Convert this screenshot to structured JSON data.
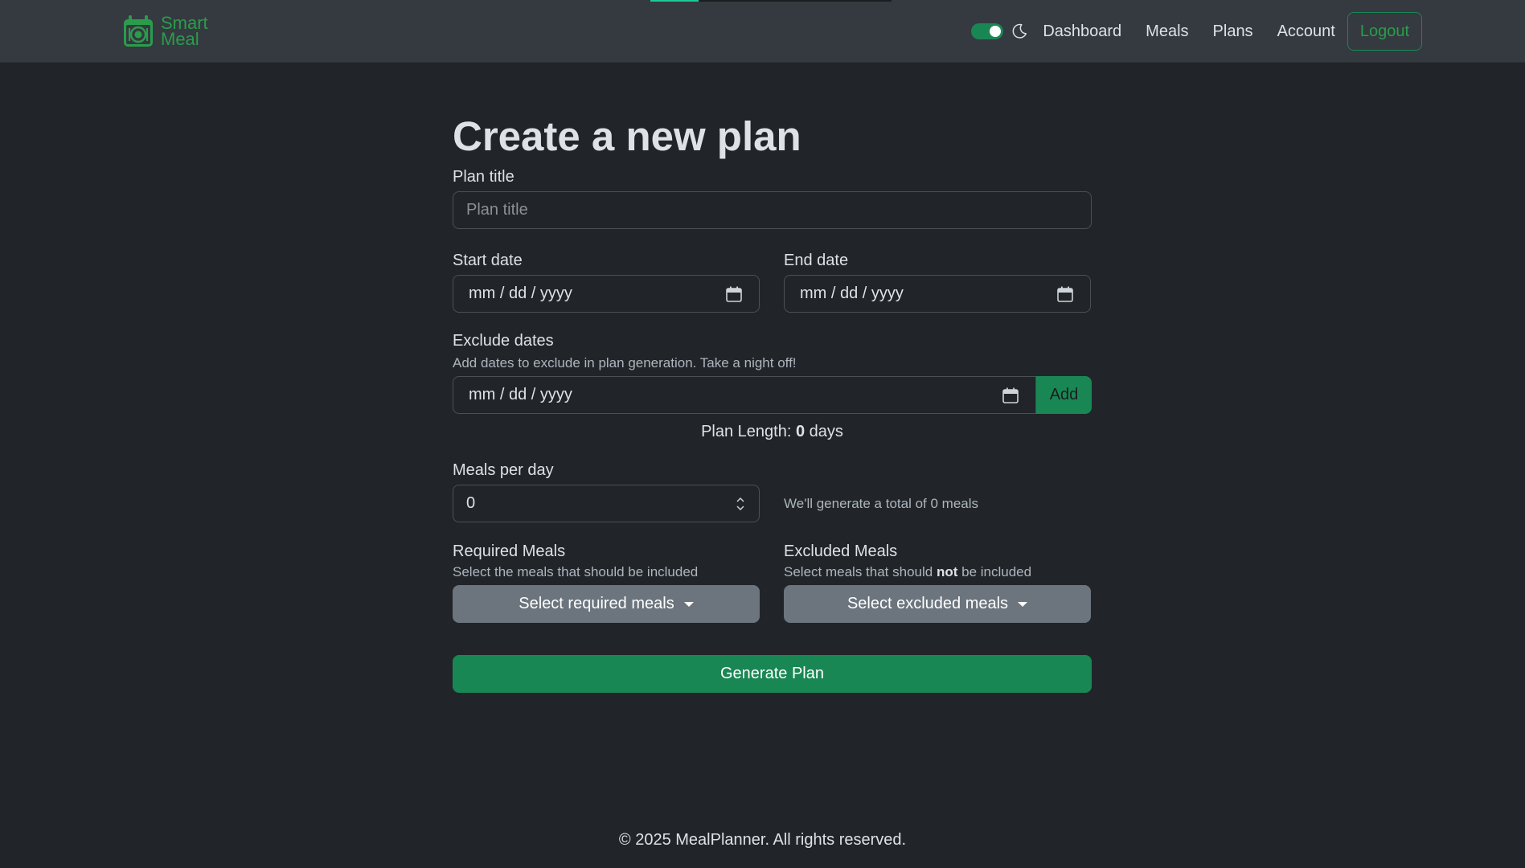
{
  "brand": {
    "line1": "Smart",
    "line2": "Meal"
  },
  "nav": {
    "theme_toggle_on": true,
    "links": [
      "Dashboard",
      "Meals",
      "Plans",
      "Account"
    ],
    "logout": "Logout"
  },
  "form": {
    "title": "Create a new plan",
    "plan_title": {
      "label": "Plan title",
      "placeholder": "Plan title",
      "value": ""
    },
    "start_date": {
      "label": "Start date",
      "placeholder": "mm / dd / yyyy"
    },
    "end_date": {
      "label": "End date",
      "placeholder": "mm / dd / yyyy"
    },
    "exclude_dates": {
      "label": "Exclude dates",
      "help": "Add dates to exclude in plan generation. Take a night off!",
      "placeholder": "mm / dd / yyyy",
      "add_label": "Add"
    },
    "plan_length": {
      "prefix": "Plan Length: ",
      "value": "0",
      "suffix": " days"
    },
    "meals_per_day": {
      "label": "Meals per day",
      "value": "0",
      "total_text": "We'll generate a total of 0 meals"
    },
    "required_meals": {
      "label": "Required Meals",
      "help": "Select the meals that should be included",
      "button": "Select required meals"
    },
    "excluded_meals": {
      "label": "Excluded Meals",
      "help_prefix": "Select meals that should ",
      "help_bold": "not",
      "help_suffix": " be included",
      "button": "Select excluded meals"
    },
    "generate_label": "Generate Plan"
  },
  "footer": {
    "text": "© 2025 MealPlanner. All rights reserved."
  },
  "colors": {
    "background": "#212529",
    "navbar": "#343a40",
    "success": "#198754",
    "secondary": "#6c757d"
  }
}
